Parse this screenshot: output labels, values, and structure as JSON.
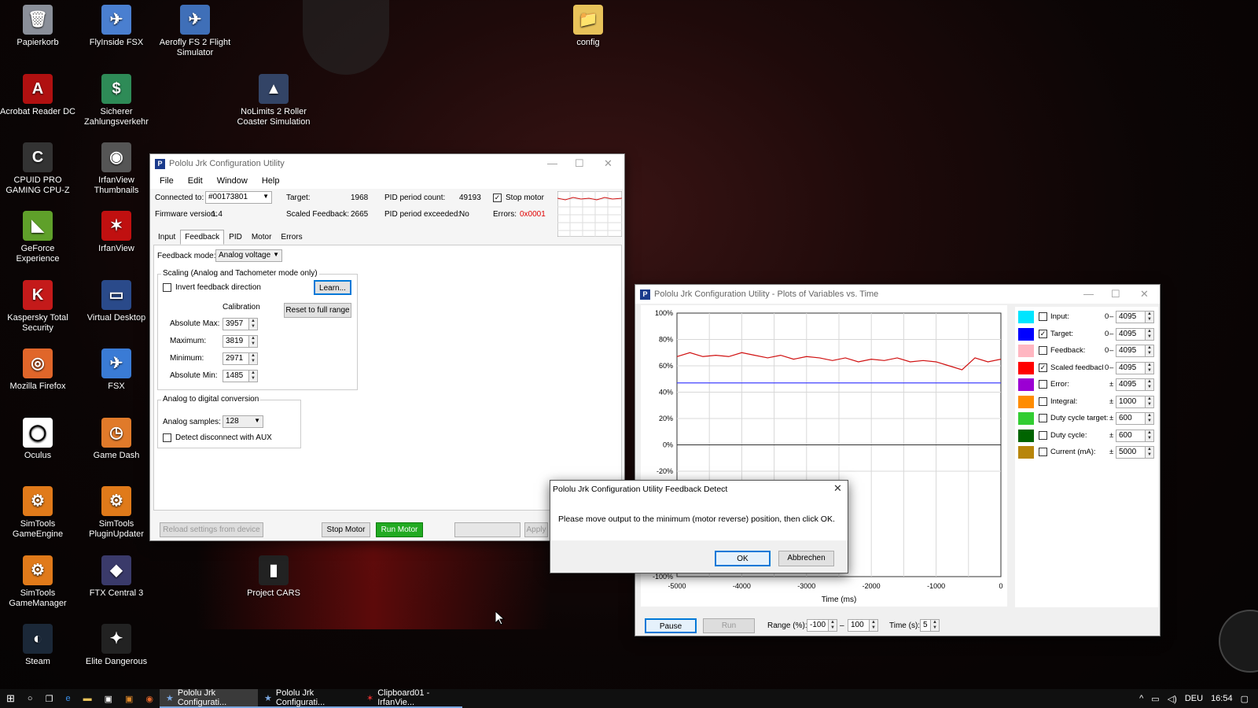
{
  "desktop": {
    "icons": [
      {
        "label": "Papierkorb",
        "color": "#8a8f99",
        "glyph": "🗑"
      },
      {
        "label": "FlyInside FSX",
        "color": "#4a7fd0",
        "glyph": "✈"
      },
      {
        "label": "Aerofly FS 2 Flight Simulator",
        "color": "#3f6fb8",
        "glyph": "✈"
      },
      {
        "label": "config",
        "color": "#e8c25a",
        "glyph": "📁"
      },
      {
        "label": "Acrobat Reader DC",
        "color": "#b01010",
        "glyph": "A"
      },
      {
        "label": "Sicherer Zahlungsverkehr",
        "color": "#2e8b57",
        "glyph": "$"
      },
      {
        "label": "NoLimits 2 Roller Coaster Simulation",
        "color": "#334466",
        "glyph": "▲"
      },
      {
        "label": "CPUID PRO GAMING CPU-Z",
        "color": "#333",
        "glyph": "C"
      },
      {
        "label": "IrfanView Thumbnails",
        "color": "#555",
        "glyph": "◉"
      },
      {
        "label": "GeForce Experience",
        "color": "#5fa02a",
        "glyph": "◣"
      },
      {
        "label": "IrfanView",
        "color": "#c01010",
        "glyph": "✶"
      },
      {
        "label": "Kaspersky Total Security",
        "color": "#c41a1a",
        "glyph": "K"
      },
      {
        "label": "Virtual Desktop",
        "color": "#2a4a8a",
        "glyph": "▭"
      },
      {
        "label": "Mozilla Firefox",
        "color": "#e0662a",
        "glyph": "◎"
      },
      {
        "label": "FSX",
        "color": "#3a7bd5",
        "glyph": "✈"
      },
      {
        "label": "Oculus",
        "color": "#ffffff",
        "glyph": "◯"
      },
      {
        "label": "Game Dash",
        "color": "#e07a2a",
        "glyph": "◷"
      },
      {
        "label": "SimTools GameEngine",
        "color": "#e07a1a",
        "glyph": "⚙"
      },
      {
        "label": "SimTools PluginUpdater",
        "color": "#e07a1a",
        "glyph": "⚙"
      },
      {
        "label": "Project CARS",
        "color": "#222",
        "glyph": "▮"
      },
      {
        "label": "SimTools GameManager",
        "color": "#e07a1a",
        "glyph": "⚙"
      },
      {
        "label": "FTX Central 3",
        "color": "#3a3a6a",
        "glyph": "◆"
      },
      {
        "label": "Steam",
        "color": "#1b2838",
        "glyph": "◐"
      },
      {
        "label": "Elite Dangerous",
        "color": "#222",
        "glyph": "✦"
      }
    ]
  },
  "main_window": {
    "title": "Pololu Jrk Configuration Utility",
    "menu": [
      "File",
      "Edit",
      "Window",
      "Help"
    ],
    "connected_label": "Connected to:",
    "connected_value": "#00173801",
    "firmware_label": "Firmware version:",
    "firmware_value": "1.4",
    "target_label": "Target:",
    "target_value": "1968",
    "scaled_label": "Scaled Feedback:",
    "scaled_value": "2665",
    "pid_count_label": "PID period count:",
    "pid_count_value": "49193",
    "pid_exceeded_label": "PID period exceeded:",
    "pid_exceeded_value": "No",
    "stop_motor_label": "Stop motor",
    "errors_label": "Errors:",
    "errors_value": "0x0001",
    "tabs": [
      "Input",
      "Feedback",
      "PID",
      "Motor",
      "Errors"
    ],
    "feedback_mode_label": "Feedback mode:",
    "feedback_mode_value": "Analog voltage",
    "scaling_title": "Scaling (Analog and Tachometer mode only)",
    "invert_label": "Invert feedback direction",
    "learn_label": "Learn...",
    "calibration_label": "Calibration",
    "reset_label": "Reset to full range",
    "abs_max_label": "Absolute Max:",
    "abs_max_value": "3957",
    "max_label": "Maximum:",
    "max_value": "3819",
    "min_label": "Minimum:",
    "min_value": "2971",
    "abs_min_label": "Absolute Min:",
    "abs_min_value": "1485",
    "adc_title": "Analog to digital conversion",
    "samples_label": "Analog samples:",
    "samples_value": "128",
    "detect_label": "Detect disconnect with AUX",
    "reload_label": "Reload settings from device",
    "stop_btn_label": "Stop Motor",
    "run_btn_label": "Run Motor",
    "apply_label": "Apply"
  },
  "plot_window": {
    "title": "Pololu Jrk Configuration Utility - Plots of Variables vs. Time",
    "y_ticks": [
      "100%",
      "80%",
      "60%",
      "40%",
      "20%",
      "0%",
      "-20%",
      "-100%"
    ],
    "x_ticks": [
      "-5000",
      "-4000",
      "-3000",
      "-2000",
      "-1000",
      "0"
    ],
    "x_label": "Time (ms)",
    "pause_label": "Pause",
    "run_label": "Run",
    "range_label": "Range (%):",
    "range_min": "-100",
    "range_dash": "–",
    "range_max": "100",
    "time_label": "Time (s):",
    "time_value": "5",
    "variables": [
      {
        "name": "Input:",
        "color": "#00e5ff",
        "checked": false,
        "min": "0",
        "sep": "–",
        "max": "4095"
      },
      {
        "name": "Target:",
        "color": "#0000ff",
        "checked": true,
        "min": "0",
        "sep": "–",
        "max": "4095"
      },
      {
        "name": "Feedback:",
        "color": "#ffb6c1",
        "checked": false,
        "min": "0",
        "sep": "–",
        "max": "4095"
      },
      {
        "name": "Scaled feedbacl",
        "color": "#ff0000",
        "checked": true,
        "min": "0",
        "sep": "–",
        "max": "4095"
      },
      {
        "name": "Error:",
        "color": "#9b00d3",
        "checked": false,
        "min": "",
        "sep": "±",
        "max": "4095"
      },
      {
        "name": "Integral:",
        "color": "#ff8c00",
        "checked": false,
        "min": "",
        "sep": "±",
        "max": "1000"
      },
      {
        "name": "Duty cycle target:",
        "color": "#32cd32",
        "checked": false,
        "min": "",
        "sep": "±",
        "max": "600"
      },
      {
        "name": "Duty cycle:",
        "color": "#006400",
        "checked": false,
        "min": "",
        "sep": "±",
        "max": "600"
      },
      {
        "name": "Current (mA):",
        "color": "#b8860b",
        "checked": false,
        "min": "",
        "sep": "±",
        "max": "5000"
      }
    ]
  },
  "chart_data": {
    "type": "line",
    "xlabel": "Time (ms)",
    "ylabel": "",
    "xlim": [
      -5000,
      0
    ],
    "ylim": [
      -100,
      100
    ],
    "grid": true,
    "series": [
      {
        "name": "Target:",
        "color": "#4040ff",
        "x": [
          -5000,
          0
        ],
        "values": [
          47,
          47
        ]
      },
      {
        "name": "Scaled feedbacl",
        "color": "#d01010",
        "x": [
          -5000,
          -4800,
          -4600,
          -4400,
          -4200,
          -4000,
          -3800,
          -3600,
          -3400,
          -3200,
          -3000,
          -2800,
          -2600,
          -2400,
          -2200,
          -2000,
          -1800,
          -1600,
          -1400,
          -1200,
          -1000,
          -800,
          -600,
          -400,
          -200,
          0
        ],
        "values": [
          67,
          70,
          67,
          68,
          67,
          70,
          68,
          66,
          68,
          65,
          67,
          66,
          64,
          66,
          63,
          65,
          64,
          66,
          63,
          64,
          63,
          60,
          57,
          66,
          63,
          65
        ]
      }
    ]
  },
  "dialog": {
    "title": "Pololu Jrk Configuration Utility Feedback Detect",
    "message": "Please move output to the minimum (motor reverse) position, then click OK.",
    "ok": "OK",
    "cancel": "Abbrechen"
  },
  "taskbar": {
    "tasks": [
      "Pololu Jrk Configurati...",
      "Pololu Jrk Configurati...",
      "Clipboard01 - IrfanVie..."
    ],
    "lang": "DEU",
    "time": "16:54"
  }
}
